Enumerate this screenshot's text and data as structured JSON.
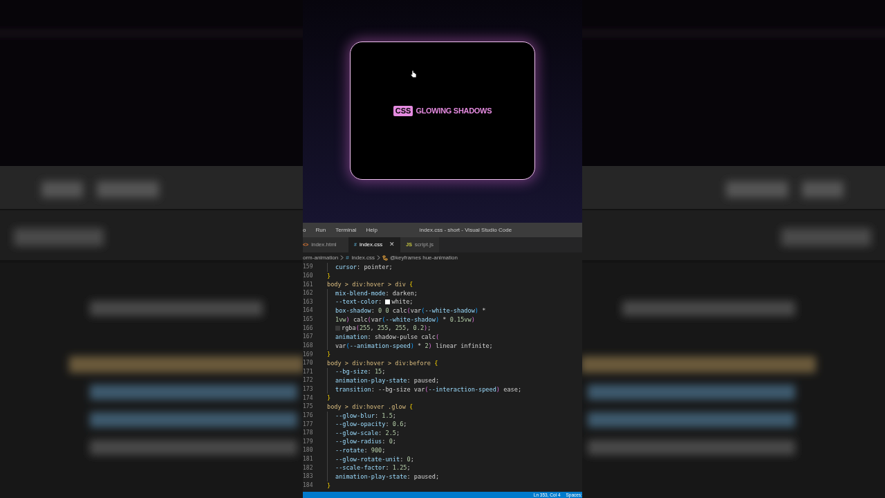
{
  "preview": {
    "badge": "CSS",
    "title": "GLOWING SHADOWS"
  },
  "editor": {
    "menu": [
      "o",
      "Run",
      "Terminal",
      "Help"
    ],
    "title": "index.css - short - Visual Studio Code",
    "tabs": [
      {
        "label": "index.html",
        "icon": "<>",
        "kind": "html",
        "selected": false
      },
      {
        "label": "index.css",
        "icon": "#",
        "kind": "css",
        "selected": true,
        "close": "✕"
      },
      {
        "label": "script.js",
        "icon": "JS",
        "kind": "js",
        "selected": false
      }
    ],
    "breadcrumb": [
      {
        "label": "orm-animation",
        "kind": "folder"
      },
      {
        "label": "index.css",
        "kind": "file",
        "icon": "#"
      },
      {
        "label": "@keyframes hue-animation",
        "kind": "symbol"
      }
    ],
    "lines": [
      {
        "n": "159",
        "kind": "decl",
        "tokens": [
          {
            "kind": "prop",
            "t": "cursor"
          },
          {
            "kind": "plain",
            "t": ": pointer;"
          }
        ]
      },
      {
        "n": "160",
        "kind": "rule",
        "tokens": [
          {
            "kind": "brace",
            "t": "}"
          }
        ]
      },
      {
        "n": "161",
        "kind": "rule",
        "tokens": [
          {
            "kind": "sel",
            "t": "body > div:hover > div "
          },
          {
            "kind": "brace",
            "t": "{"
          }
        ]
      },
      {
        "n": "162",
        "kind": "decl",
        "tokens": [
          {
            "kind": "prop",
            "t": "mix-blend-mode"
          },
          {
            "kind": "plain",
            "t": ": darken;"
          }
        ]
      },
      {
        "n": "163",
        "kind": "decl",
        "tokens": [
          {
            "kind": "prop",
            "t": "--text-color"
          },
          {
            "kind": "plain",
            "t": ": "
          },
          {
            "kind": "swatch",
            "color": "#ffffff"
          },
          {
            "kind": "plain",
            "t": "white;"
          }
        ]
      },
      {
        "n": "164",
        "kind": "decl",
        "tokens": [
          {
            "kind": "prop",
            "t": "box-shadow"
          },
          {
            "kind": "plain",
            "t": ": "
          },
          {
            "kind": "num",
            "t": "0 0 "
          },
          {
            "kind": "plain",
            "t": "calc"
          },
          {
            "kind": "paren",
            "t": "("
          },
          {
            "kind": "plain",
            "t": "var"
          },
          {
            "kind": "paren2",
            "t": "("
          },
          {
            "kind": "prop",
            "t": "--white-shadow"
          },
          {
            "kind": "paren2",
            "t": ")"
          },
          {
            "kind": "plain",
            "t": " *"
          }
        ]
      },
      {
        "n": "165",
        "kind": "decl",
        "tokens": [
          {
            "kind": "num",
            "t": "1vw"
          },
          {
            "kind": "paren",
            "t": ")"
          },
          {
            "kind": "plain",
            "t": " calc"
          },
          {
            "kind": "paren",
            "t": "("
          },
          {
            "kind": "plain",
            "t": "var"
          },
          {
            "kind": "paren2",
            "t": "("
          },
          {
            "kind": "prop",
            "t": "--white-shadow"
          },
          {
            "kind": "paren2",
            "t": ")"
          },
          {
            "kind": "plain",
            "t": " * "
          },
          {
            "kind": "num",
            "t": "0.15vw"
          },
          {
            "kind": "paren",
            "t": ")"
          }
        ]
      },
      {
        "n": "166",
        "kind": "decl",
        "tokens": [
          {
            "kind": "swatch",
            "color": "#3a3a3a"
          },
          {
            "kind": "plain",
            "t": "rgba"
          },
          {
            "kind": "paren",
            "t": "("
          },
          {
            "kind": "num",
            "t": "255"
          },
          {
            "kind": "plain",
            "t": ", "
          },
          {
            "kind": "num",
            "t": "255"
          },
          {
            "kind": "plain",
            "t": ", "
          },
          {
            "kind": "num",
            "t": "255"
          },
          {
            "kind": "plain",
            "t": ", "
          },
          {
            "kind": "num",
            "t": "0.2"
          },
          {
            "kind": "paren",
            "t": ")"
          },
          {
            "kind": "plain",
            "t": ";"
          }
        ]
      },
      {
        "n": "167",
        "kind": "decl",
        "tokens": [
          {
            "kind": "prop",
            "t": "animation"
          },
          {
            "kind": "plain",
            "t": ": shadow-pulse calc"
          },
          {
            "kind": "paren",
            "t": "("
          }
        ]
      },
      {
        "n": "168",
        "kind": "decl",
        "tokens": [
          {
            "kind": "plain",
            "t": "var"
          },
          {
            "kind": "paren2",
            "t": "("
          },
          {
            "kind": "prop",
            "t": "--animation-speed"
          },
          {
            "kind": "paren2",
            "t": ")"
          },
          {
            "kind": "plain",
            "t": " * "
          },
          {
            "kind": "num",
            "t": "2"
          },
          {
            "kind": "paren",
            "t": ")"
          },
          {
            "kind": "plain",
            "t": " linear infinite;"
          }
        ]
      },
      {
        "n": "169",
        "kind": "rule",
        "tokens": [
          {
            "kind": "brace",
            "t": "}"
          }
        ]
      },
      {
        "n": "170",
        "kind": "rule",
        "tokens": [
          {
            "kind": "sel",
            "t": "body > div:hover > div:before "
          },
          {
            "kind": "brace",
            "t": "{"
          }
        ]
      },
      {
        "n": "171",
        "kind": "decl",
        "tokens": [
          {
            "kind": "prop",
            "t": "--bg-size"
          },
          {
            "kind": "plain",
            "t": ": "
          },
          {
            "kind": "num",
            "t": "15"
          },
          {
            "kind": "plain",
            "t": ";"
          }
        ]
      },
      {
        "n": "172",
        "kind": "decl",
        "tokens": [
          {
            "kind": "prop",
            "t": "animation-play-state"
          },
          {
            "kind": "plain",
            "t": ": paused;"
          }
        ]
      },
      {
        "n": "173",
        "kind": "decl",
        "tokens": [
          {
            "kind": "prop",
            "t": "transition"
          },
          {
            "kind": "plain",
            "t": ": --bg-size var"
          },
          {
            "kind": "paren",
            "t": "("
          },
          {
            "kind": "prop",
            "t": "--interaction-speed"
          },
          {
            "kind": "paren",
            "t": ")"
          },
          {
            "kind": "plain",
            "t": " ease;"
          }
        ]
      },
      {
        "n": "174",
        "kind": "rule",
        "tokens": [
          {
            "kind": "brace",
            "t": "}"
          }
        ]
      },
      {
        "n": "175",
        "kind": "rule",
        "tokens": [
          {
            "kind": "sel",
            "t": "body > div:hover .glow "
          },
          {
            "kind": "brace",
            "t": "{"
          }
        ]
      },
      {
        "n": "176",
        "kind": "decl",
        "tokens": [
          {
            "kind": "prop",
            "t": "--glow-blur"
          },
          {
            "kind": "plain",
            "t": ": "
          },
          {
            "kind": "num",
            "t": "1.5"
          },
          {
            "kind": "plain",
            "t": ";"
          }
        ]
      },
      {
        "n": "177",
        "kind": "decl",
        "tokens": [
          {
            "kind": "prop",
            "t": "--glow-opacity"
          },
          {
            "kind": "plain",
            "t": ": "
          },
          {
            "kind": "num",
            "t": "0.6"
          },
          {
            "kind": "plain",
            "t": ";"
          }
        ]
      },
      {
        "n": "178",
        "kind": "decl",
        "tokens": [
          {
            "kind": "prop",
            "t": "--glow-scale"
          },
          {
            "kind": "plain",
            "t": ": "
          },
          {
            "kind": "num",
            "t": "2.5"
          },
          {
            "kind": "plain",
            "t": ";"
          }
        ]
      },
      {
        "n": "179",
        "kind": "decl",
        "tokens": [
          {
            "kind": "prop",
            "t": "--glow-radius"
          },
          {
            "kind": "plain",
            "t": ": "
          },
          {
            "kind": "num",
            "t": "0"
          },
          {
            "kind": "plain",
            "t": ";"
          }
        ]
      },
      {
        "n": "180",
        "kind": "decl",
        "tokens": [
          {
            "kind": "prop",
            "t": "--rotate"
          },
          {
            "kind": "plain",
            "t": ": "
          },
          {
            "kind": "num",
            "t": "900"
          },
          {
            "kind": "plain",
            "t": ";"
          }
        ]
      },
      {
        "n": "181",
        "kind": "decl",
        "tokens": [
          {
            "kind": "prop",
            "t": "--glow-rotate-unit"
          },
          {
            "kind": "plain",
            "t": ": "
          },
          {
            "kind": "num",
            "t": "0"
          },
          {
            "kind": "plain",
            "t": ";"
          }
        ]
      },
      {
        "n": "182",
        "kind": "decl",
        "tokens": [
          {
            "kind": "prop",
            "t": "--scale-factor"
          },
          {
            "kind": "plain",
            "t": ": "
          },
          {
            "kind": "num",
            "t": "1.25"
          },
          {
            "kind": "plain",
            "t": ";"
          }
        ]
      },
      {
        "n": "183",
        "kind": "decl",
        "tokens": [
          {
            "kind": "prop",
            "t": "animation-play-state"
          },
          {
            "kind": "plain",
            "t": ": paused;"
          }
        ]
      },
      {
        "n": "184",
        "kind": "rule",
        "tokens": [
          {
            "kind": "brace",
            "t": "}"
          }
        ]
      }
    ],
    "status_bar": [
      "Ln 353, Col 4",
      "Spaces:"
    ]
  }
}
